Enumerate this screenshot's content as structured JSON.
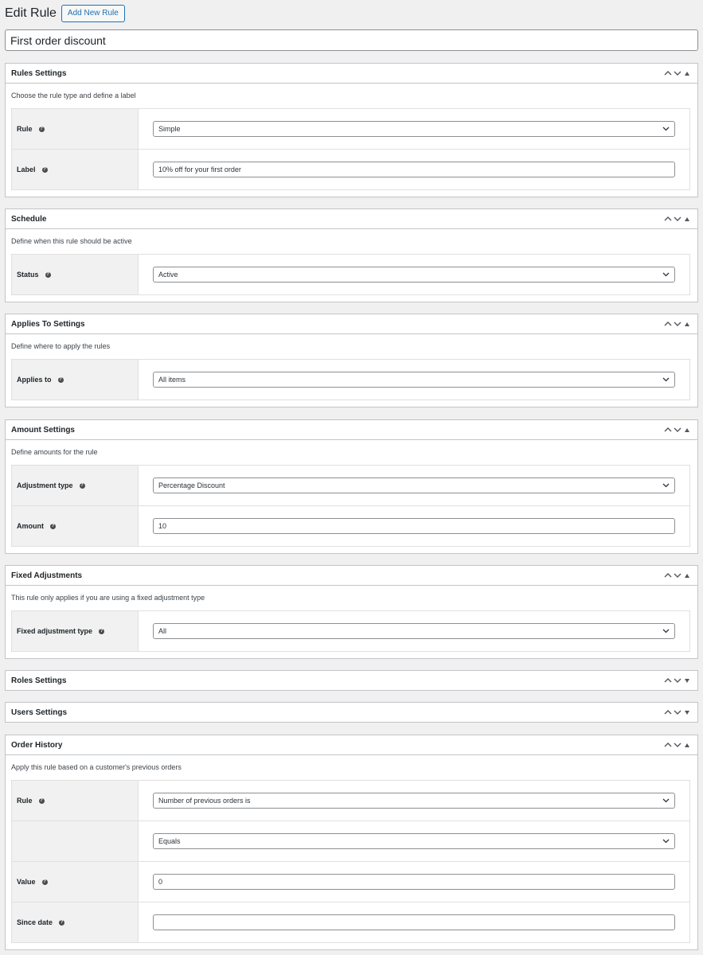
{
  "header": {
    "title": "Edit Rule",
    "add_new_label": "Add New Rule"
  },
  "rule_title": "First order discount",
  "sections": {
    "rules": {
      "title": "Rules Settings",
      "description": "Choose the rule type and define a label",
      "rows": [
        {
          "label": "Rule",
          "type": "select",
          "value": "Simple"
        },
        {
          "label": "Label",
          "type": "text",
          "value": "10% off for your first order"
        }
      ]
    },
    "schedule": {
      "title": "Schedule",
      "description": "Define when this rule should be active",
      "rows": [
        {
          "label": "Status",
          "type": "select",
          "value": "Active"
        }
      ]
    },
    "applies": {
      "title": "Applies To Settings",
      "description": "Define where to apply the rules",
      "rows": [
        {
          "label": "Applies to",
          "type": "select",
          "value": "All items"
        }
      ]
    },
    "amount": {
      "title": "Amount Settings",
      "description": "Define amounts for the rule",
      "rows": [
        {
          "label": "Adjustment type",
          "type": "select",
          "value": "Percentage Discount"
        },
        {
          "label": "Amount",
          "type": "text",
          "value": "10"
        }
      ]
    },
    "fixed": {
      "title": "Fixed Adjustments",
      "description": "This rule only applies if you are using a fixed adjustment type",
      "rows": [
        {
          "label": "Fixed adjustment type",
          "type": "select",
          "value": "All"
        }
      ]
    },
    "roles": {
      "title": "Roles Settings"
    },
    "users": {
      "title": "Users Settings"
    },
    "history": {
      "title": "Order History",
      "description": "Apply this rule based on a customer's previous orders",
      "rows": [
        {
          "label": "Rule",
          "type": "select",
          "value": "Number of previous orders is"
        },
        {
          "label": "",
          "type": "select",
          "value": "Equals"
        },
        {
          "label": "Value",
          "type": "text",
          "value": "0"
        },
        {
          "label": "Since date",
          "type": "text",
          "value": ""
        }
      ]
    }
  },
  "icons": {
    "help": "question-circle-icon",
    "move_up": "chevron-up-icon",
    "move_down": "chevron-down-icon",
    "toggle_open": "triangle-up-icon",
    "toggle_closed": "triangle-down-icon",
    "select_arrow": "chevron-down-icon"
  },
  "colors": {
    "background": "#f0f0f1",
    "panel_border": "#c3c4c7",
    "label_cell": "#f1f1f1",
    "link": "#2271b1",
    "text": "#1d2327"
  }
}
